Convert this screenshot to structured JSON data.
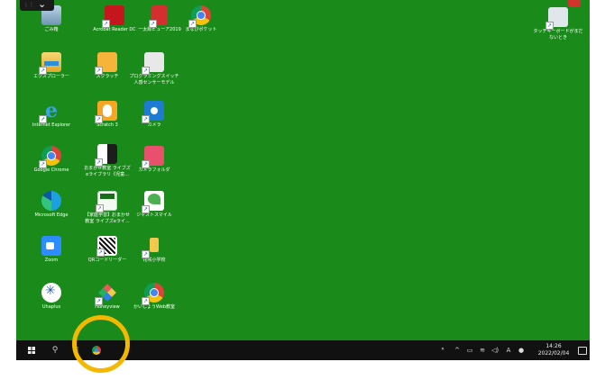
{
  "desktop": {
    "icons": [
      {
        "label": "ごみ箱",
        "icon": "trash-icon"
      },
      {
        "label": "Acrobat Reader DC",
        "icon": "acrobat-icon"
      },
      {
        "label": "一太郎ビューア2019",
        "icon": "ichitaro-icon"
      },
      {
        "label": "まなびポケット",
        "icon": "chrome-icon"
      },
      {
        "label": "エクスプローラー",
        "icon": "file-explorer-icon"
      },
      {
        "label": "スクラッチ",
        "icon": "scratch-cat-icon"
      },
      {
        "label": "プログラミングスイッチ\n人感センサーモデル",
        "icon": "document-icon"
      },
      {
        "label": "Internet Explorer",
        "icon": "internet-explorer-icon"
      },
      {
        "label": "Scratch 3",
        "icon": "scratch3-icon"
      },
      {
        "label": "カメラ",
        "icon": "camera-icon"
      },
      {
        "label": "Google Chrome",
        "icon": "chrome-icon"
      },
      {
        "label": "おまかせ教室 ライブズ\neライブラリ《児童...",
        "icon": "omakase-icon"
      },
      {
        "label": "カメラフォルダ",
        "icon": "camera-folder-icon"
      },
      {
        "label": "Microsoft Edge",
        "icon": "edge-icon"
      },
      {
        "label": "【家庭学習】おまかせ\n教室 ライブズeライ...",
        "icon": "home-study-icon"
      },
      {
        "label": "ジャストスマイル",
        "icon": "just-smile-icon"
      },
      {
        "label": "Zoom",
        "icon": "zoom-icon"
      },
      {
        "label": "QRコードリーダー",
        "icon": "qr-code-icon"
      },
      {
        "label": "花咲小学校",
        "icon": "school-folder-icon"
      },
      {
        "label": "Uhaplus",
        "icon": "uhaplus-icon"
      },
      {
        "label": "Honeyview",
        "icon": "honeyview-icon"
      },
      {
        "label": "かいしょうWeb教室",
        "icon": "chrome-icon"
      }
    ],
    "touch_keyboard_label": "タッチキーボードがまだ\nないとき"
  },
  "taskbar": {
    "start_icon": "windows-start-icon",
    "search_icon": "search-icon",
    "pinned": [
      {
        "name": "Google Chrome",
        "icon": "chrome-icon"
      }
    ],
    "tray_glyphs": {
      "person": "ᴿ",
      "chevron": "^",
      "battery": "▭",
      "wifi": "≋",
      "volume": "◁)",
      "ime": "A",
      "status": "●"
    },
    "clock_time": "14:26",
    "clock_date": "2022/02/04"
  },
  "colors": {
    "desktop_bg": "#1a8a1a",
    "taskbar_bg": "#111111",
    "highlight": "#f5b800"
  }
}
